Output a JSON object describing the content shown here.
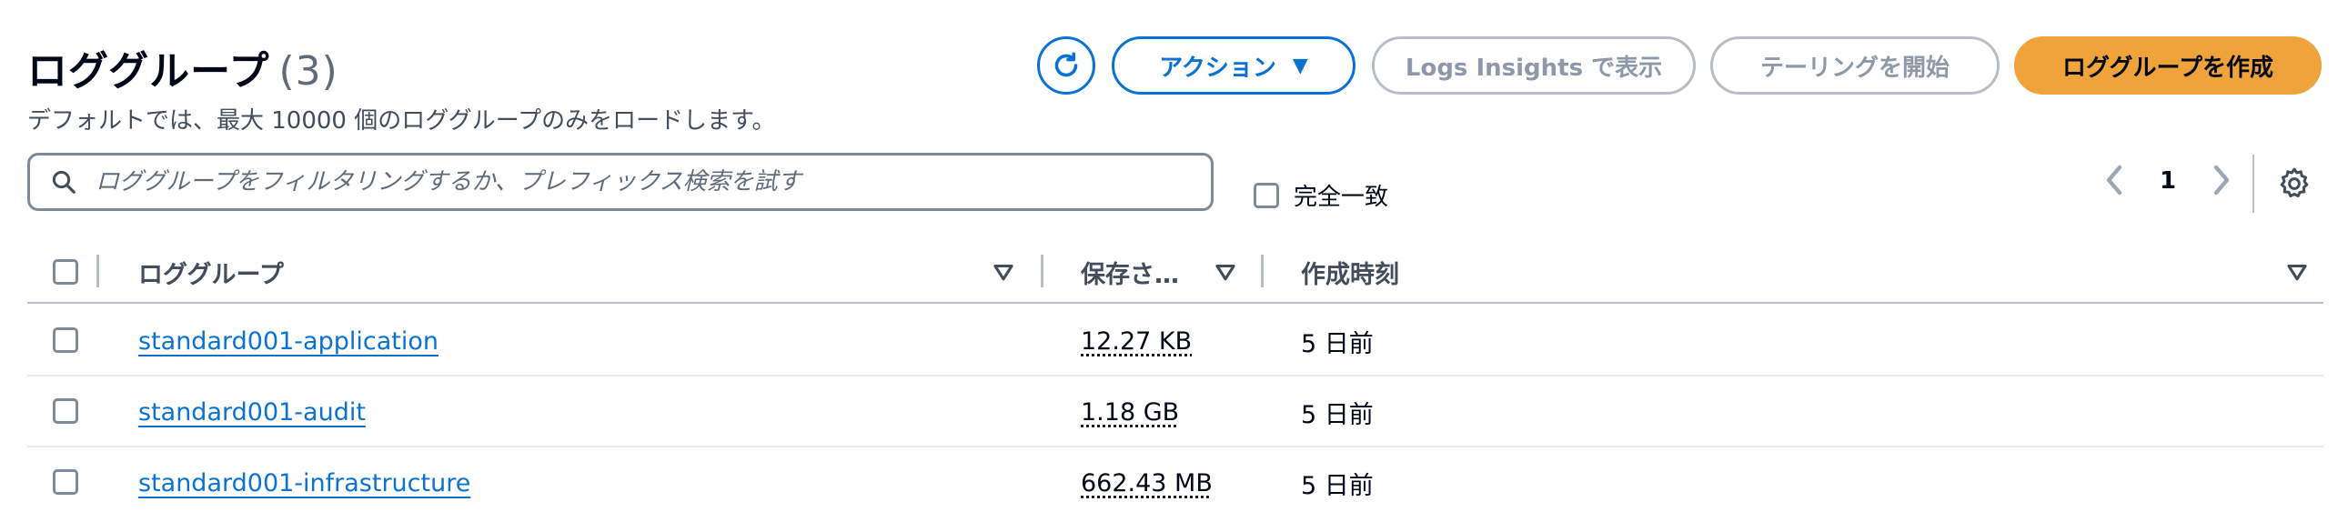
{
  "header": {
    "title": "ロググループ",
    "count": "(3)",
    "subtitle": "デフォルトでは、最大 10000 個のロググループのみをロードします。"
  },
  "toolbar": {
    "actions_label": "アクション",
    "insights_label": "Logs Insights で表示",
    "tail_label": "テーリングを開始",
    "create_label": "ロググループを作成"
  },
  "search": {
    "placeholder": "ロググループをフィルタリングするか、プレフィックス検索を試す",
    "value": ""
  },
  "exact_match": {
    "label": "完全一致",
    "checked": false
  },
  "pagination": {
    "page": "1"
  },
  "table": {
    "columns": [
      "ロググループ",
      "保存さ…",
      "作成時刻"
    ],
    "rows": [
      {
        "name": "standard001-application",
        "size": "12.27 KB",
        "created": "5 日前"
      },
      {
        "name": "standard001-audit",
        "size": "1.18 GB",
        "created": "5 日前"
      },
      {
        "name": "standard001-infrastructure",
        "size": "662.43 MB",
        "created": "5 日前"
      }
    ]
  },
  "colors": {
    "accent": "#0972d3",
    "primary_button": "#f0a23b",
    "disabled": "#8d99a8",
    "text": "#000716"
  },
  "icons": [
    "refresh-icon",
    "caret-down-icon",
    "search-icon",
    "chevron-left-icon",
    "chevron-right-icon",
    "gear-icon",
    "sort-icon"
  ]
}
